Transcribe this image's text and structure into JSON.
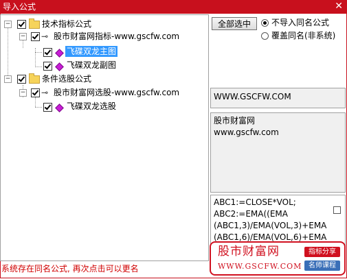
{
  "window": {
    "title": "导入公式",
    "close_glyph": "✕"
  },
  "tree": {
    "group1_label": "技术指标公式",
    "group1_item_label": "股市财富网指标-www.gscfw.com",
    "group1_child1": "飞碟双龙主图",
    "group1_child2": "飞碟双龙副图",
    "group2_label": "条件选股公式",
    "group2_item_label": "股市财富网选股-www.gscfw.com",
    "group2_child1": "飞碟双龙选股",
    "selected_item": "飞碟双龙主图"
  },
  "actions": {
    "select_all_label": "全部选中",
    "radio1_label": "不导入同名公式",
    "radio2_label": "覆盖同名(非系统)",
    "radio_selected": "不导入同名公式"
  },
  "info": {
    "website": "WWW.GSCFW.COM",
    "desc_line1": "股市财富网",
    "desc_line2": "www.gscfw.com"
  },
  "code": {
    "line1": "ABC1:=CLOSE*VOL;",
    "line2": "ABC2:=EMA((EMA",
    "line3": "(ABC1,3)/EMA(VOL,3)+EMA",
    "line4": "(ABC1,6)/EMA(VOL,6)+EMA"
  },
  "status": {
    "text": "系统存在同名公式, 再次点击可以更名"
  },
  "watermark": {
    "name": "股市财富网",
    "url": "WWW.GSCFW.COM",
    "tag1": "指标分享",
    "tag2": "名师课程"
  },
  "colors": {
    "titlebar": "#c8101d",
    "selection": "#3399ff",
    "status_text": "#d00000",
    "watermark_red": "#d0101f",
    "watermark_blue": "#3a6fb8",
    "formula_icon": "#c81cd6",
    "folder": "#f6d35a"
  },
  "icons": [
    "close-icon",
    "folder-icon",
    "key-icon",
    "formula-diamond-icon",
    "checkbox-checked-icon",
    "tree-collapse-icon"
  ]
}
